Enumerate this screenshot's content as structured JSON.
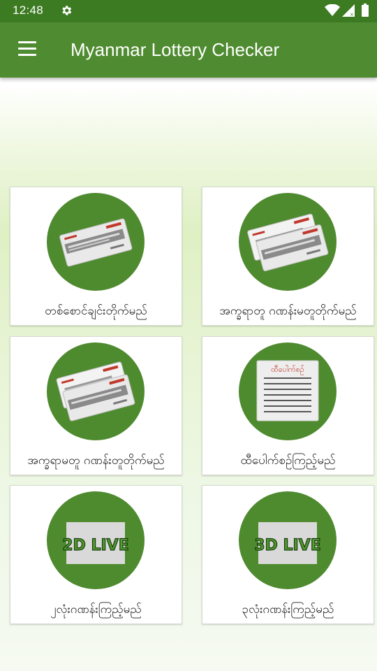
{
  "status_bar": {
    "time": "12:48",
    "icons": [
      "gear-icon",
      "wifi-icon",
      "signal-icon",
      "battery-icon"
    ]
  },
  "app_bar": {
    "title": "Myanmar Lottery Checker",
    "menu_icon": "hamburger-menu-icon"
  },
  "colors": {
    "status_bar": "#3d7b23",
    "app_bar": "#4f8b30",
    "circle": "#4e8a2e",
    "ticket_red": "#c0392b"
  },
  "menu_items": [
    {
      "label": "တစ်စောင်ချင်းတိုက်မည်",
      "icon": "single-ticket-icon"
    },
    {
      "label": "အက္ခရာတူ ဂဏန်းမတူတိုက်မည်",
      "icon": "ticket-pair-icon"
    },
    {
      "label": "အက္ခရာမတူ ဂဏန်းတူတိုက်မည်",
      "icon": "ticket-pair-icon"
    },
    {
      "label": "ထီပေါက်စဥ်ကြည့်မည်",
      "icon": "result-list-icon",
      "card_title": "ထီပေါက်စဥ်"
    },
    {
      "label": "၂လုံးဂဏန်းကြည့်မည်",
      "icon": "live-badge-icon",
      "badge": "2D LIVE"
    },
    {
      "label": "၃လုံးဂဏန်းကြည့်မည်",
      "icon": "live-badge-icon",
      "badge": "3D LIVE"
    }
  ]
}
